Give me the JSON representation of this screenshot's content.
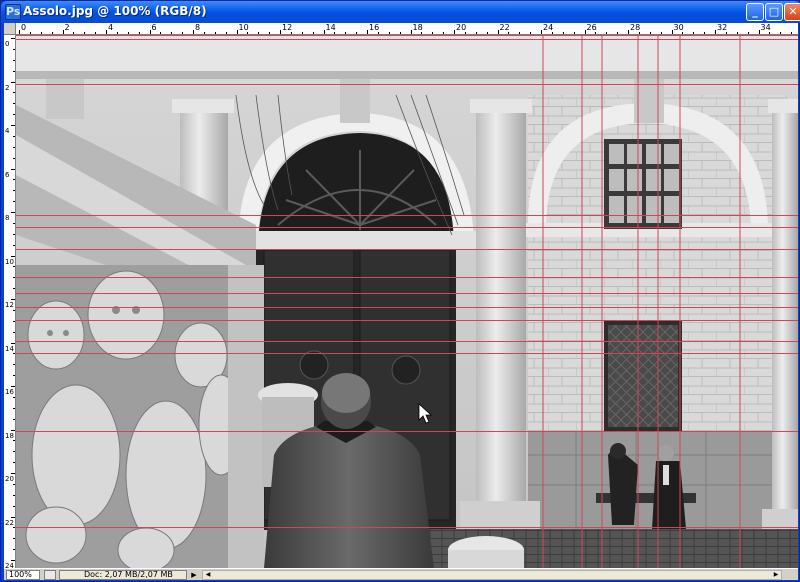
{
  "window": {
    "title": "Assolo.jpg @ 100% (RGB/8)",
    "icon_letter": "Ps",
    "controls": {
      "minimize": "_",
      "maximize": "□",
      "close": "✕"
    }
  },
  "ruler": {
    "top_labels": [
      "0",
      "2",
      "4",
      "6",
      "8",
      "10",
      "12",
      "14",
      "16",
      "18",
      "20",
      "22",
      "24",
      "26",
      "28",
      "30",
      "32",
      "34"
    ],
    "left_labels": [
      "0",
      "2",
      "4",
      "6",
      "8",
      "10",
      "12",
      "14",
      "16",
      "18",
      "20",
      "22",
      "24"
    ]
  },
  "statusbar": {
    "zoom": "100%",
    "doc_info": "Doc: 2,07 MB/2,07 MB",
    "arrow": "▶"
  },
  "colors": {
    "guide": "#d0455a",
    "title_bar": "#0a5ae8",
    "close_button": "#d5431c"
  },
  "icons": [
    "photoshop-document-icon",
    "minimize-icon",
    "maximize-icon",
    "close-icon",
    "navigator-icon",
    "scroll-left-icon",
    "scroll-right-icon",
    "mouse-pointer-icon"
  ]
}
